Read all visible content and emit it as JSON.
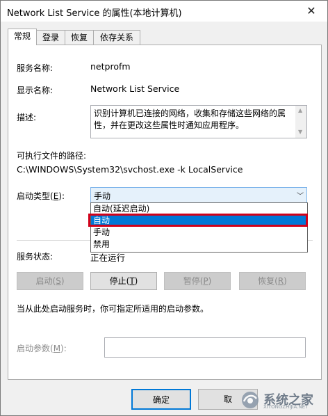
{
  "window": {
    "title": "Network List Service 的属性(本地计算机)",
    "close_glyph": "✕"
  },
  "tabs": [
    {
      "label": "常规",
      "active": true
    },
    {
      "label": "登录",
      "active": false
    },
    {
      "label": "恢复",
      "active": false
    },
    {
      "label": "依存关系",
      "active": false
    }
  ],
  "general": {
    "service_name_label": "服务名称:",
    "service_name_value": "netprofm",
    "display_name_label": "显示名称:",
    "display_name_value": "Network List Service",
    "description_label": "描述:",
    "description_value": "识别计算机已连接的网络，收集和存储这些网络的属性，并在更改这些属性时通知应用程序。",
    "exe_path_label": "可执行文件的路径:",
    "exe_path_value": "C:\\WINDOWS\\System32\\svchost.exe -k LocalService",
    "startup_type_label_prefix": "启动类型(",
    "startup_type_label_key": "E",
    "startup_type_label_suffix": "):",
    "startup_type_value": "手动",
    "startup_options": [
      {
        "label": "自动(延迟启动)",
        "selected": false
      },
      {
        "label": "自动",
        "selected": true
      },
      {
        "label": "手动",
        "selected": false
      },
      {
        "label": "禁用",
        "selected": false
      }
    ],
    "service_status_label": "服务状态:",
    "service_status_value": "正在运行",
    "start_prefix": "启动(",
    "start_key": "S",
    "start_suffix": ")",
    "stop_prefix": "停止(",
    "stop_key": "T",
    "stop_suffix": ")",
    "pause_prefix": "暂停(",
    "pause_key": "P",
    "pause_suffix": ")",
    "resume_prefix": "恢复(",
    "resume_key": "R",
    "resume_suffix": ")",
    "hint_text": "当从此处启动服务时，你可指定所适用的启动参数。",
    "start_params_prefix": "启动参数(",
    "start_params_key": "M",
    "start_params_suffix": "):",
    "start_params_value": ""
  },
  "footer": {
    "ok_label": "确定",
    "cancel_label": "取"
  },
  "watermark": {
    "text": "系统之家",
    "sub": "XITONGZHIJIA.NET"
  },
  "colors": {
    "selection": "#0078d7",
    "highlight_frame": "#d0021b"
  }
}
